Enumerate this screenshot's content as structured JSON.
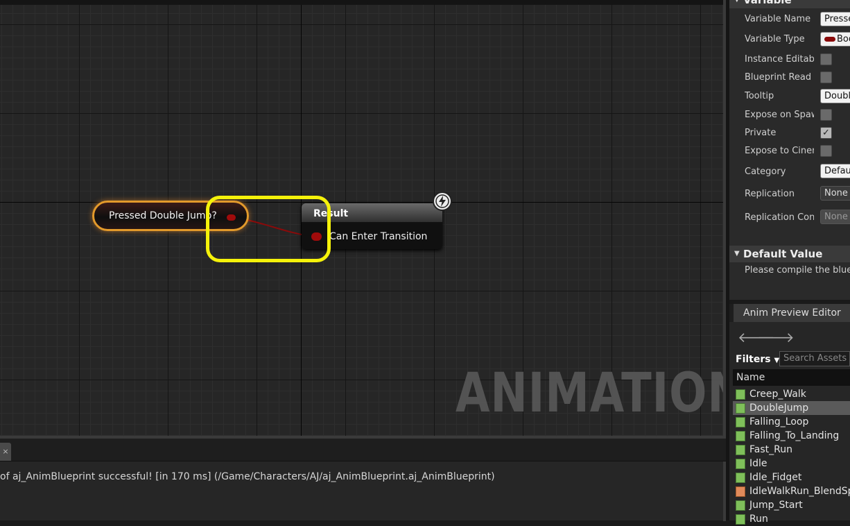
{
  "graph": {
    "watermark": "ANIMATION",
    "variable_node": {
      "label": "Pressed Double Jump?"
    },
    "result_node": {
      "title": "Result",
      "pin_label": "Can Enter Transition"
    }
  },
  "output_log": {
    "tab_label": "×",
    "message": "of aj_AnimBlueprint successful! [in 170 ms] (/Game/Characters/AJ/aj_AnimBlueprint.aj_AnimBlueprint)"
  },
  "details": {
    "variable_section": "Variable",
    "properties": [
      {
        "label": "Variable Name",
        "value": "Pressed"
      },
      {
        "label": "Variable Type",
        "value": "Boo"
      },
      {
        "label": "Instance Editable",
        "checked": false
      },
      {
        "label": "Blueprint Read Only",
        "checked": false
      },
      {
        "label": "Tooltip",
        "value": "Double"
      },
      {
        "label": "Expose on Spawn",
        "checked": false
      },
      {
        "label": "Private",
        "checked": true
      },
      {
        "label": "Expose to Cinematics",
        "checked": false
      },
      {
        "label": "Category",
        "value": "Default"
      },
      {
        "label": "Replication",
        "value": "None"
      },
      {
        "label": "Replication Condition",
        "value": "None"
      }
    ],
    "default_value_section": "Default Value",
    "default_value_message": "Please compile the blueprint"
  },
  "anim_preview": {
    "tab_label": "Anim Preview Editor",
    "filters_label": "Filters",
    "search_placeholder": "Search Assets",
    "name_header": "Name",
    "assets": [
      {
        "name": "Creep_Walk",
        "kind": "sequence",
        "selected": false
      },
      {
        "name": "DoubleJump",
        "kind": "sequence",
        "selected": true
      },
      {
        "name": "Falling_Loop",
        "kind": "sequence",
        "selected": false
      },
      {
        "name": "Falling_To_Landing",
        "kind": "sequence",
        "selected": false
      },
      {
        "name": "Fast_Run",
        "kind": "sequence",
        "selected": false
      },
      {
        "name": "Idle",
        "kind": "sequence",
        "selected": false
      },
      {
        "name": "Idle_Fidget",
        "kind": "sequence",
        "selected": false
      },
      {
        "name": "IdleWalkRun_BlendSpace",
        "kind": "blendspace",
        "selected": false
      },
      {
        "name": "Jump_Start",
        "kind": "sequence",
        "selected": false
      },
      {
        "name": "Run",
        "kind": "sequence",
        "selected": false
      }
    ]
  },
  "colors": {
    "highlight": "#f5f20a",
    "bool_pin": "#a00b0b",
    "node_glow": "#e39a2b"
  }
}
